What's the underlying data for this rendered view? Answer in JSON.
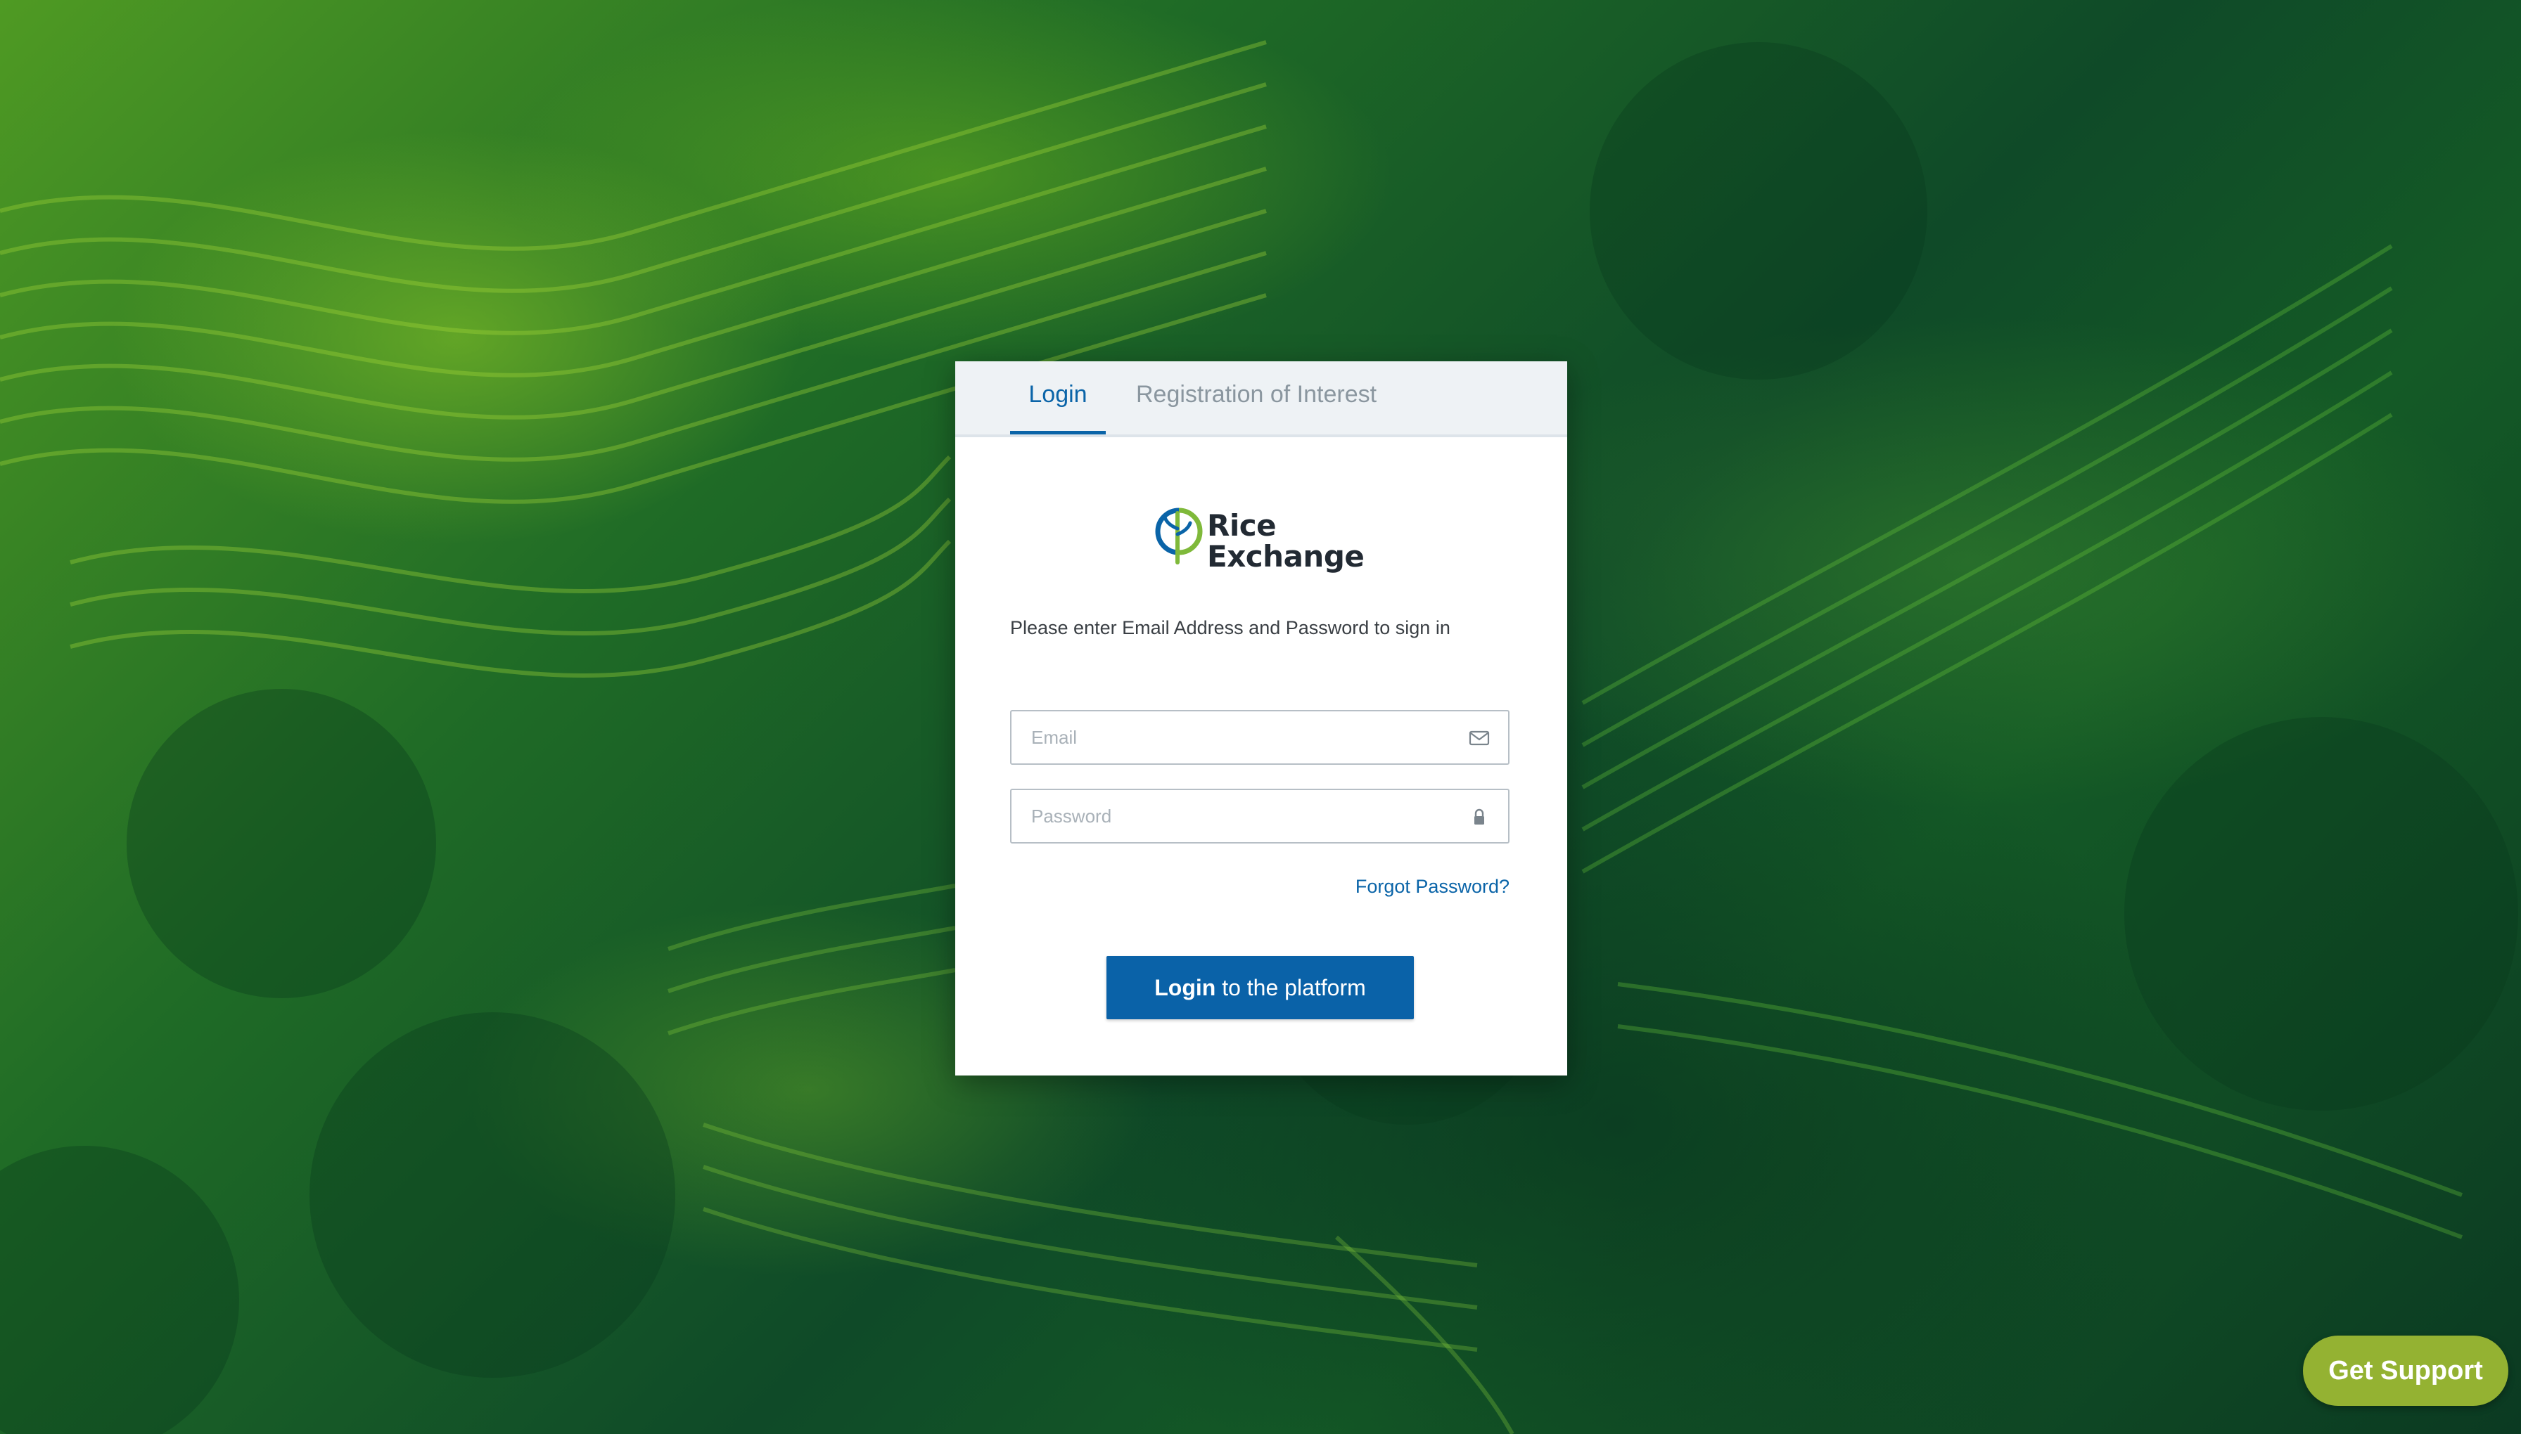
{
  "tabs": {
    "login": "Login",
    "registration": "Registration of Interest"
  },
  "logo": {
    "line1": "Rice",
    "line2": "Exchange"
  },
  "instructions": "Please enter Email Address and Password to sign in",
  "email": {
    "placeholder": "Email",
    "value": ""
  },
  "password": {
    "placeholder": "Password",
    "value": ""
  },
  "forgot_password": "Forgot Password?",
  "login_button": {
    "strong": "Login",
    "rest": " to the platform"
  },
  "support_button": "Get Support",
  "icons": {
    "email_field": "envelope-icon",
    "password_field": "lock-icon",
    "logo": "rice-plant-icon"
  },
  "colors": {
    "primary": "#0a62a8",
    "support": "#94b232",
    "logo_green": "#7fb93a",
    "logo_blue": "#0a64a8"
  }
}
